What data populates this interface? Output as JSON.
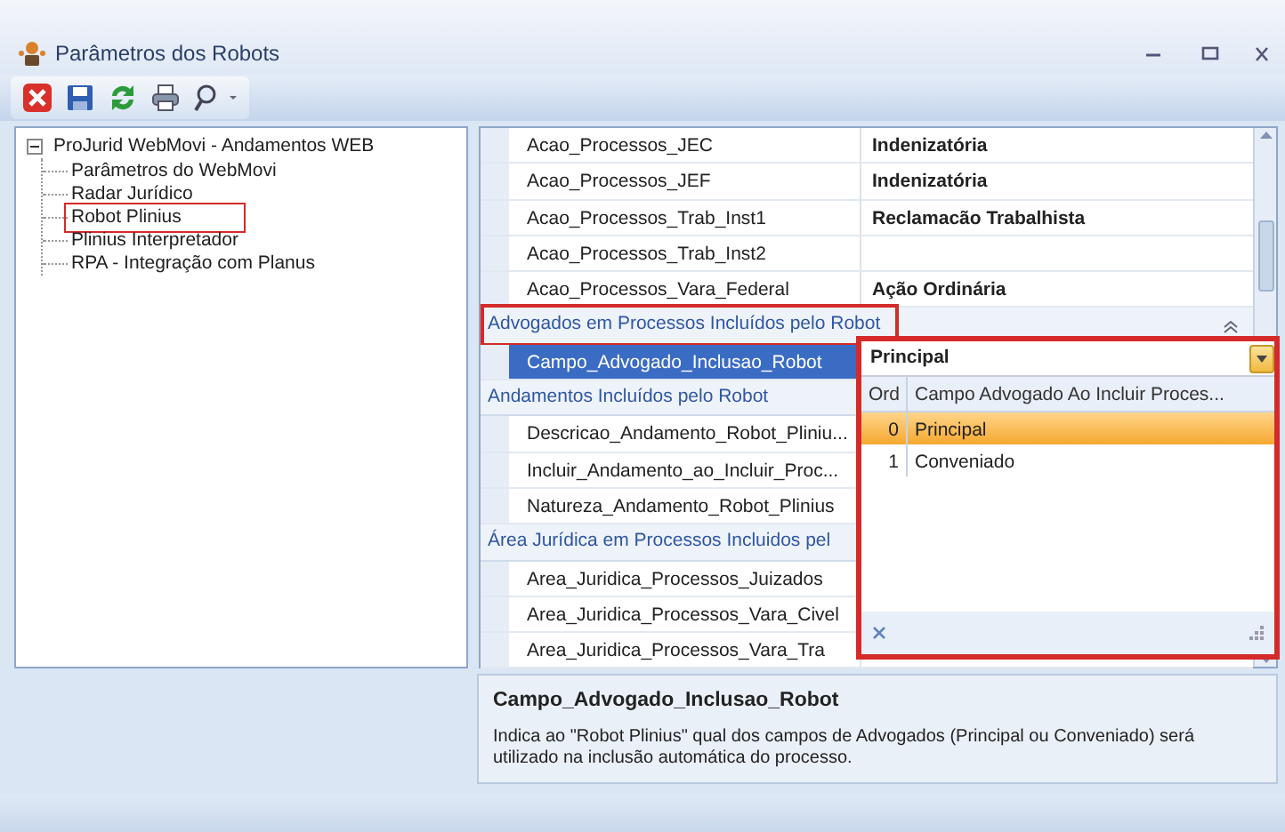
{
  "window": {
    "title": "Parâmetros dos Robots"
  },
  "toolbar": {
    "buttons": [
      {
        "kind": "close"
      },
      {
        "kind": "save"
      },
      {
        "kind": "refresh"
      },
      {
        "kind": "print"
      },
      {
        "kind": "search"
      }
    ]
  },
  "tree": {
    "label": "ProJurid WebMovi - Andamentos WEB",
    "expanded": true,
    "children": [
      {
        "label": "Parâmetros do WebMovi",
        "highlighted": false
      },
      {
        "label": "Radar Jurídico",
        "highlighted": false
      },
      {
        "label": "Robot Plinius",
        "highlighted": true
      },
      {
        "label": "Plinius Interpretador",
        "highlighted": false
      },
      {
        "label": "RPA - Integração com Planus",
        "highlighted": false
      }
    ]
  },
  "grid": {
    "groups": [
      {
        "rows": [
          {
            "name": "Acao_Processos_JEC",
            "value": "Indenizatória",
            "selected": false
          },
          {
            "name": "Acao_Processos_JEF",
            "value": "Indenizatória",
            "selected": false
          },
          {
            "name": "Acao_Processos_Trab_Inst1",
            "value": "Reclamacão Trabalhista",
            "selected": false
          },
          {
            "name": "Acao_Processos_Trab_Inst2",
            "selected": false
          },
          {
            "name": "Acao_Processos_Vara_Federal",
            "value": "Ação Ordinária",
            "selected": false
          }
        ]
      },
      {
        "title": "Advogados em Processos Incluídos pelo Robot",
        "highlighted": true,
        "expanded": true,
        "rows": [
          {
            "name": "Campo_Advogado_Inclusao_Robot",
            "selected": true
          }
        ]
      },
      {
        "title": "Andamentos Incluídos pelo Robot",
        "highlighted": false,
        "rows": [
          {
            "name": "Descricao_Andamento_Robot_Pliniu...",
            "selected": false
          },
          {
            "name": "Incluir_Andamento_ao_Incluir_Proc...",
            "selected": false
          },
          {
            "name": "Natureza_Andamento_Robot_Plinius",
            "selected": false
          }
        ]
      },
      {
        "title": "Área Jurídica em Processos Incluidos pel",
        "highlighted": false,
        "rows": [
          {
            "name": "Area_Juridica_Processos_Juizados",
            "selected": false
          },
          {
            "name": "Area_Juridica_Processos_Vara_Civel",
            "selected": false
          },
          {
            "name": "Area_Juridica_Processos_Vara_Tra",
            "selected": false
          }
        ]
      }
    ]
  },
  "dropdown": {
    "value": "Principal",
    "highlighted": true,
    "columns": [
      "Ord",
      "Campo Advogado Ao Incluir Proces..."
    ],
    "rows": [
      {
        "ord": "0",
        "label": "Principal",
        "selected": true
      },
      {
        "ord": "1",
        "label": "Conveniado",
        "selected": false
      }
    ]
  },
  "description": {
    "title": "Campo_Advogado_Inclusao_Robot",
    "text": "Indica ao \"Robot Plinius\" qual dos campos de Advogados (Principal ou Conveniado) será utilizado na inclusão automática do processo."
  }
}
